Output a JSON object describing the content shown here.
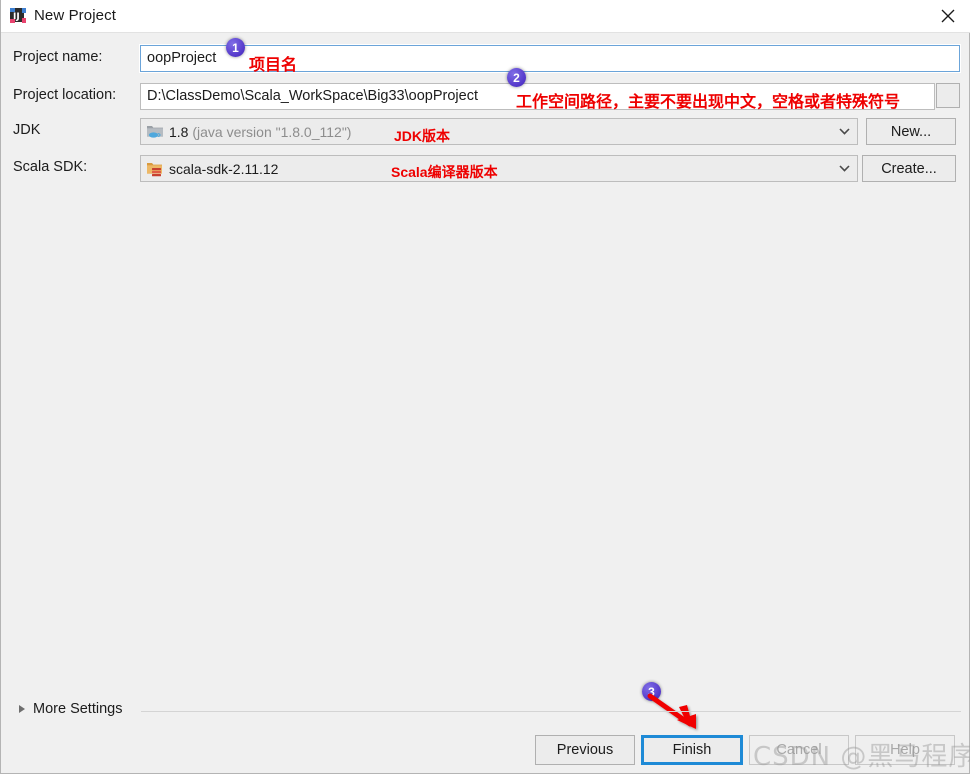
{
  "window": {
    "title": "New Project",
    "app_icon": "intellij-idea-icon",
    "close_icon": "close-icon"
  },
  "form": {
    "rows": [
      {
        "label": "Project name:",
        "value": "oopProject"
      },
      {
        "label": "Project location:",
        "value": "D:\\ClassDemo\\Scala_WorkSpace\\Big33\\oopProject"
      },
      {
        "label": "JDK",
        "value": "1.8",
        "value_detail": "(java version \"1.8.0_112\")"
      },
      {
        "label": "Scala SDK:",
        "value": "scala-sdk-2.11.12"
      }
    ],
    "buttons": {
      "jdk_new": "New...",
      "scala_create": "Create..."
    },
    "more_settings": "More Settings"
  },
  "annotations": [
    {
      "badge": "1",
      "text": "项目名"
    },
    {
      "badge": "2",
      "text": "工作空间路径，主要不要出现中文，空格或者特殊符号"
    },
    {
      "badge": "",
      "text": "JDK版本"
    },
    {
      "badge": "",
      "text": "Scala编译器版本"
    },
    {
      "badge": "3",
      "text": ""
    }
  ],
  "dialog_buttons": {
    "previous": "Previous",
    "finish": "Finish",
    "cancel": "Cancel",
    "help": "Help"
  },
  "watermark": "CSDN @黑马程序员官方",
  "colors": {
    "annotation_red": "#ee0000",
    "badge_purple": "#5337c9",
    "focus_blue": "#1e8ad6",
    "field_border_focus": "#6ba4d9",
    "dialog_bg": "#f0f0f0"
  }
}
